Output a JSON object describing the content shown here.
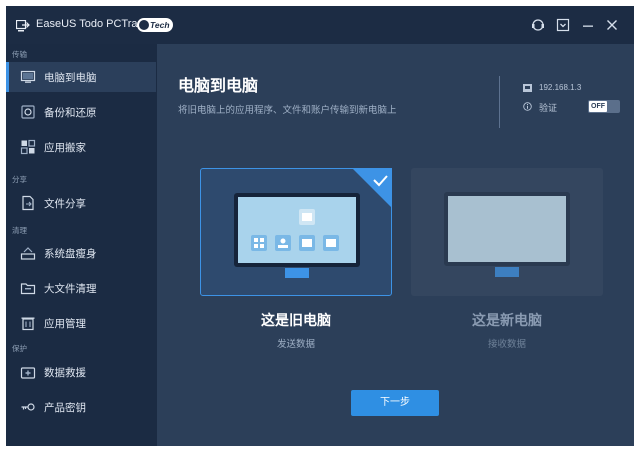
{
  "app": {
    "title": "EaseUS Todo PCTrans",
    "badge": "Tech"
  },
  "sidebar": {
    "sections": [
      "传输",
      "分享",
      "清理",
      "保护"
    ],
    "items": [
      {
        "label": "电脑到电脑",
        "icon": "computer-icon",
        "active": true
      },
      {
        "label": "备份和还原",
        "icon": "backup-icon"
      },
      {
        "label": "应用搬家",
        "icon": "app-grid-icon"
      },
      {
        "label": "文件分享",
        "icon": "file-share-icon"
      },
      {
        "label": "系统盘瘦身",
        "icon": "disk-slim-icon"
      },
      {
        "label": "大文件清理",
        "icon": "large-file-icon"
      },
      {
        "label": "应用管理",
        "icon": "trash-icon"
      },
      {
        "label": "数据救援",
        "icon": "rescue-icon"
      },
      {
        "label": "产品密钥",
        "icon": "key-icon"
      }
    ]
  },
  "main": {
    "title": "电脑到电脑",
    "subtitle": "将旧电脑上的应用程序、文件和账户传输到新电脑上",
    "ip": "192.168.1.3",
    "verify_label": "验证",
    "verify_toggle": "OFF",
    "cards": [
      {
        "label": "这是旧电脑",
        "sub": "发送数据",
        "selected": true
      },
      {
        "label": "这是新电脑",
        "sub": "接收数据",
        "selected": false
      }
    ],
    "next_label": "下一步"
  },
  "colors": {
    "accent": "#2f8fe3",
    "sidebar_bg": "#1b2b43",
    "main_bg": "#2c3f59"
  }
}
